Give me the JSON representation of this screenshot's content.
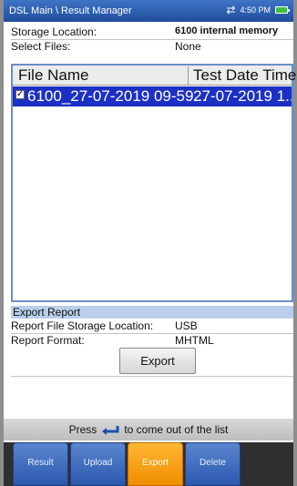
{
  "titlebar": {
    "breadcrumb": "DSL Main \\ Result Manager",
    "time": "4:50 PM"
  },
  "storage": {
    "label": "Storage Location:",
    "value": "6100 internal memory"
  },
  "select_files": {
    "label": "Select Files:",
    "value": "None"
  },
  "file_list": {
    "headers": {
      "file_name": "File Name",
      "test_date_time": "Test Date Time"
    },
    "rows": [
      {
        "checked": true,
        "file_name": "6100_27-07-2019 09-59...",
        "test_date_time": "27-07-2019 1..."
      }
    ]
  },
  "export_report": {
    "section_title": "Export Report",
    "storage_location": {
      "label": "Report File Storage Location:",
      "value": "USB"
    },
    "format": {
      "label": "Report Format:",
      "value": "MHTML"
    },
    "button_label": "Export"
  },
  "hint": {
    "prefix": "Press",
    "suffix": "to come out of the list"
  },
  "tabs": [
    {
      "label": "Result",
      "active": false
    },
    {
      "label": "Upload",
      "active": false
    },
    {
      "label": "Export",
      "active": true
    },
    {
      "label": "Delete",
      "active": false
    }
  ],
  "colors": {
    "accent_blue": "#2a58ad",
    "selection": "#1d30c4",
    "active_tab": "#f08d00"
  }
}
